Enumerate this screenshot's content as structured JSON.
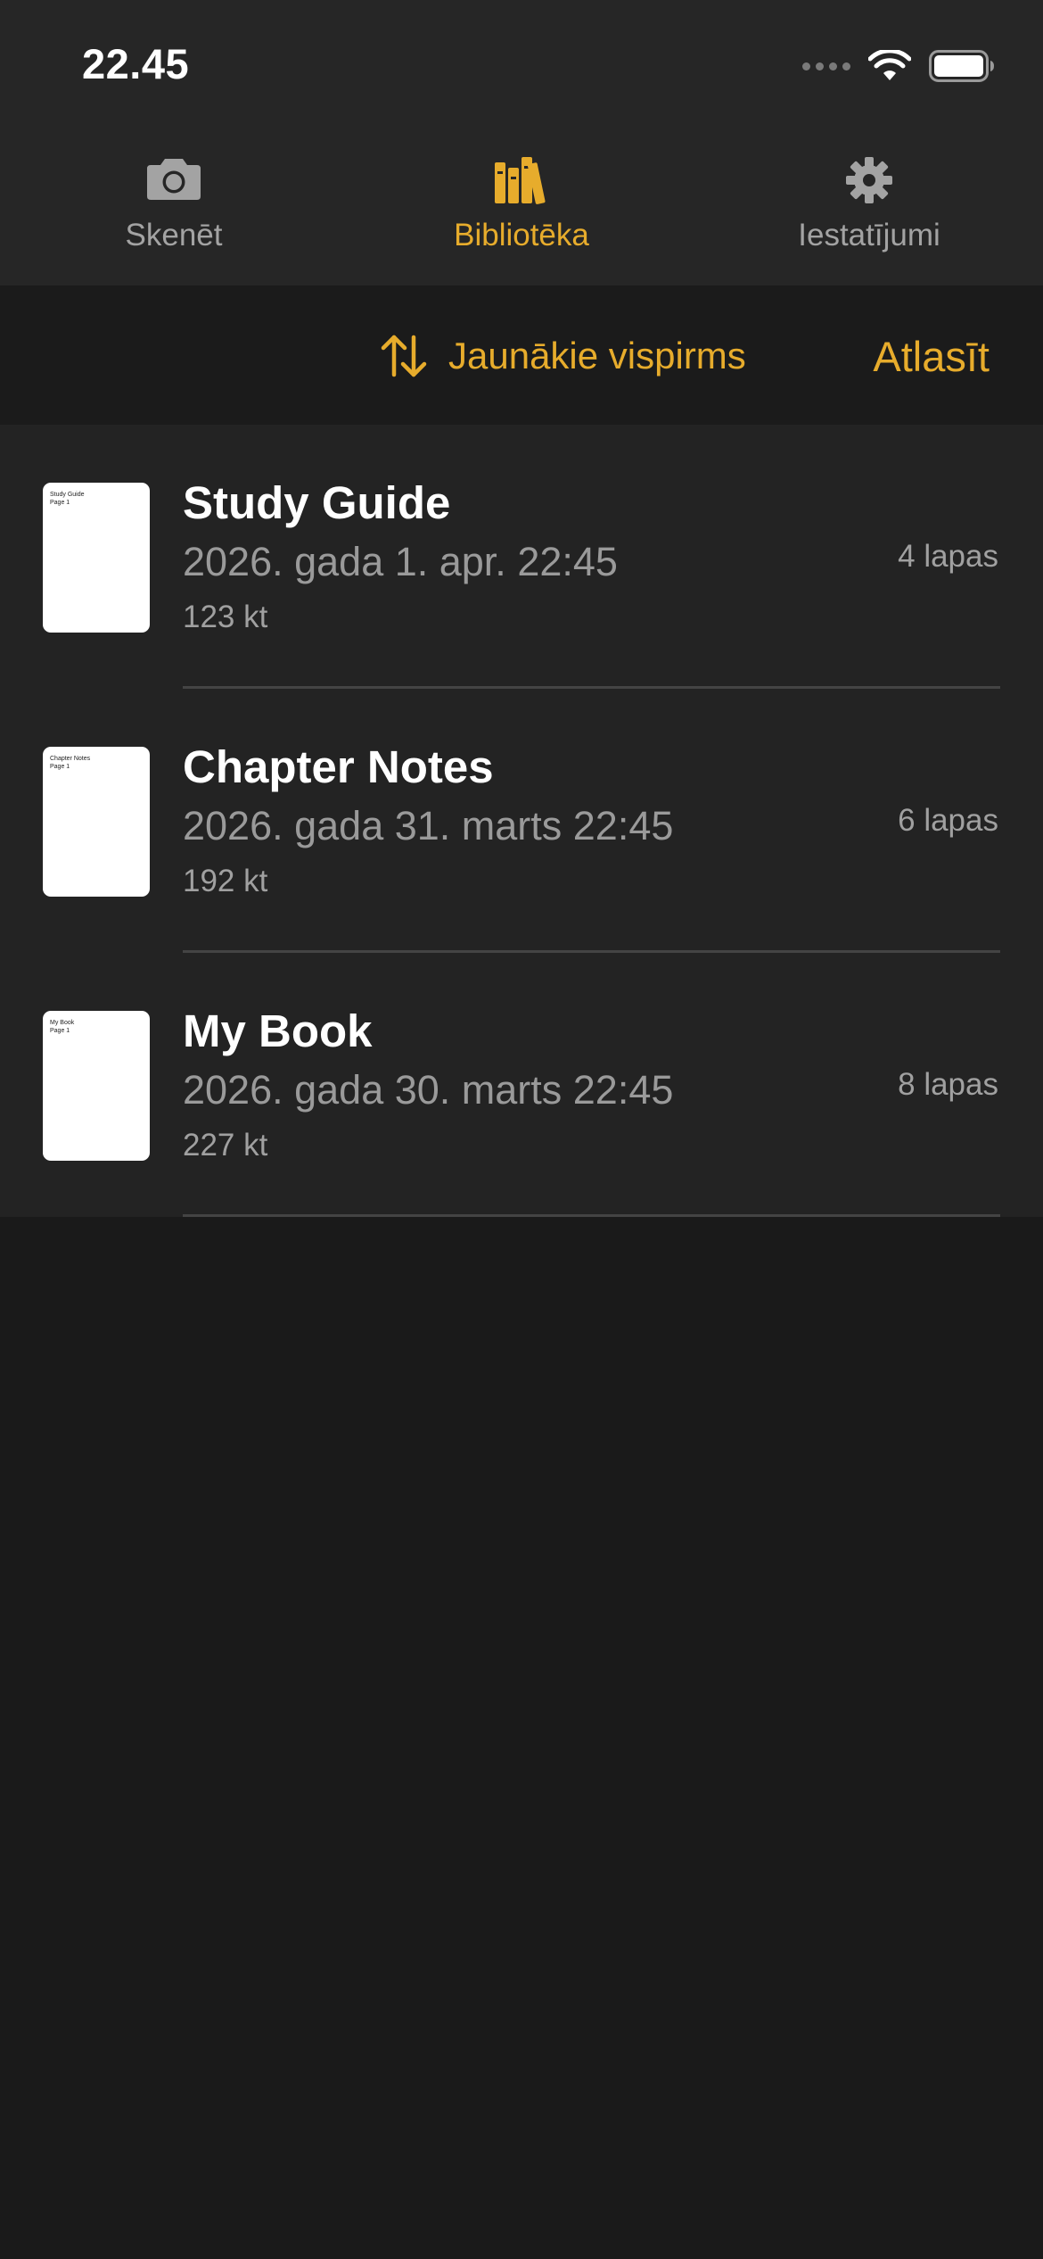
{
  "status_bar": {
    "time": "22.45"
  },
  "tabs": [
    {
      "label": "Skenēt",
      "icon": "camera-icon",
      "active": false
    },
    {
      "label": "Bibliotēka",
      "icon": "books-icon",
      "active": true
    },
    {
      "label": "Iestatījumi",
      "icon": "gear-icon",
      "active": false
    }
  ],
  "toolbar": {
    "sort_label": "Jaunākie vispirms",
    "sort_icon": "sort-arrows-icon",
    "select_label": "Atlasīt"
  },
  "documents": [
    {
      "title": "Study Guide",
      "date": "2026. gada 1. apr. 22:45",
      "size": "123 kt",
      "pages": "4 lapas",
      "thumb_text": "Study Guide\nPage 1"
    },
    {
      "title": "Chapter Notes",
      "date": "2026. gada 31. marts 22:45",
      "size": "192 kt",
      "pages": "6 lapas",
      "thumb_text": "Chapter Notes\nPage 1"
    },
    {
      "title": "My Book",
      "date": "2026. gada 30. marts 22:45",
      "size": "227 kt",
      "pages": "8 lapas",
      "thumb_text": "My Book\nPage 1"
    }
  ],
  "colors": {
    "accent": "#e7ac2c",
    "background": "#1a1a1a",
    "bar_background": "#262626",
    "list_background": "#232323",
    "secondary_text": "#9a9a9a"
  }
}
